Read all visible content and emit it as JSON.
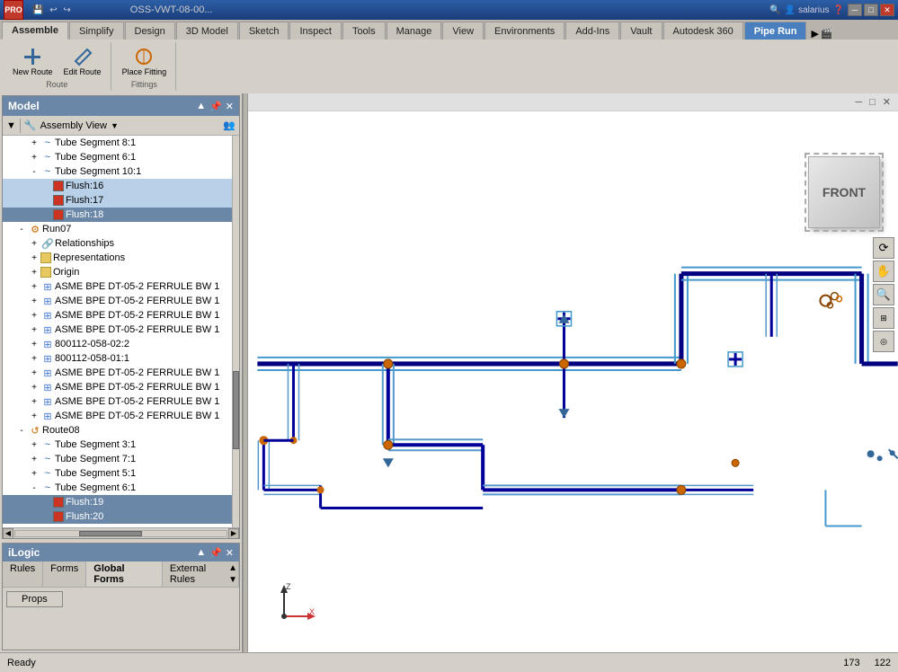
{
  "titlebar": {
    "title": "OSS-VWT-08-00...",
    "win_buttons": [
      "minimize",
      "maximize",
      "close"
    ]
  },
  "tabs": [
    {
      "label": "Assemble",
      "active": false
    },
    {
      "label": "Simplify",
      "active": false
    },
    {
      "label": "Design",
      "active": false
    },
    {
      "label": "3D Model",
      "active": false
    },
    {
      "label": "Sketch",
      "active": false
    },
    {
      "label": "Inspect",
      "active": false
    },
    {
      "label": "Tools",
      "active": false
    },
    {
      "label": "Manage",
      "active": false
    },
    {
      "label": "View",
      "active": false
    },
    {
      "label": "Environments",
      "active": false
    },
    {
      "label": "Add-Ins",
      "active": false
    },
    {
      "label": "Vault",
      "active": false
    },
    {
      "label": "Autodesk 360",
      "active": false
    },
    {
      "label": "Pipe Run",
      "active": true,
      "special": true
    }
  ],
  "model_panel": {
    "title": "Model",
    "toolbar": {
      "filter_label": "▼",
      "view_label": "Assembly View",
      "people_icon": "👥"
    },
    "tree": [
      {
        "level": 2,
        "icon": "seg",
        "label": "Tube Segment 8:1",
        "expand": "+"
      },
      {
        "level": 2,
        "icon": "seg",
        "label": "Tube Segment 6:1",
        "expand": "+"
      },
      {
        "level": 2,
        "icon": "seg",
        "label": "Tube Segment 10:1",
        "expand": "-"
      },
      {
        "level": 3,
        "icon": "sq-red",
        "label": "Flush:16",
        "expand": " "
      },
      {
        "level": 3,
        "icon": "sq-red",
        "label": "Flush:17",
        "expand": " "
      },
      {
        "level": 3,
        "icon": "sq-red",
        "label": "Flush:18",
        "expand": " ",
        "selected": true
      },
      {
        "level": 1,
        "icon": "gear",
        "label": "Run07",
        "expand": "-"
      },
      {
        "level": 2,
        "icon": "link",
        "label": "Relationships",
        "expand": "+"
      },
      {
        "level": 2,
        "icon": "folder",
        "label": "Representations",
        "expand": "+"
      },
      {
        "level": 2,
        "icon": "origin",
        "label": "Origin",
        "expand": "+"
      },
      {
        "level": 2,
        "icon": "asm",
        "label": "ASME BPE DT-05-2 FERRULE BW 1",
        "expand": "+"
      },
      {
        "level": 2,
        "icon": "asm",
        "label": "ASME BPE DT-05-2 FERRULE BW 1",
        "expand": "+"
      },
      {
        "level": 2,
        "icon": "asm",
        "label": "ASME BPE DT-05-2 FERRULE BW 1",
        "expand": "+"
      },
      {
        "level": 2,
        "icon": "asm",
        "label": "ASME BPE DT-05-2 FERRULE BW 1",
        "expand": "+"
      },
      {
        "level": 2,
        "icon": "asm",
        "label": "800112-058-02:2",
        "expand": "+"
      },
      {
        "level": 2,
        "icon": "asm",
        "label": "800112-058-01:1",
        "expand": "+"
      },
      {
        "level": 2,
        "icon": "asm",
        "label": "ASME BPE DT-05-2 FERRULE BW 1",
        "expand": "+"
      },
      {
        "level": 2,
        "icon": "asm",
        "label": "ASME BPE DT-05-2 FERRULE BW 1",
        "expand": "+"
      },
      {
        "level": 2,
        "icon": "asm",
        "label": "ASME BPE DT-05-2 FERRULE BW 1",
        "expand": "+"
      },
      {
        "level": 2,
        "icon": "asm",
        "label": "ASME BPE DT-05-2 FERRULE BW 1",
        "expand": "+"
      },
      {
        "level": 1,
        "icon": "gear",
        "label": "Route08",
        "expand": "-"
      },
      {
        "level": 2,
        "icon": "seg",
        "label": "Tube Segment 3:1",
        "expand": "+"
      },
      {
        "level": 2,
        "icon": "seg",
        "label": "Tube Segment 7:1",
        "expand": "+"
      },
      {
        "level": 2,
        "icon": "seg",
        "label": "Tube Segment 5:1",
        "expand": "+"
      },
      {
        "level": 2,
        "icon": "seg",
        "label": "Tube Segment 6:1",
        "expand": "-"
      },
      {
        "level": 3,
        "icon": "sq-red",
        "label": "Flush:19",
        "expand": " ",
        "selected": true
      },
      {
        "level": 3,
        "icon": "sq-red",
        "label": "Flush:20",
        "expand": " ",
        "selected": true
      }
    ]
  },
  "ilogic_panel": {
    "title": "iLogic",
    "tabs": [
      "Rules",
      "Forms",
      "Global Forms",
      "External Rules"
    ],
    "active_tab": "Global Forms",
    "props_button": "Props"
  },
  "viewport": {
    "nav_cube_label": "FRONT",
    "axis_labels": {
      "z": "Z",
      "x": "X"
    }
  },
  "status_bar": {
    "status": "Ready",
    "coord_x": "173",
    "coord_y": "122"
  },
  "view_tools": [
    "🔍",
    "✋",
    "🔄",
    "🔭",
    "⬜"
  ],
  "ribbon_arrow": "▶",
  "collapse_btn": "◀"
}
